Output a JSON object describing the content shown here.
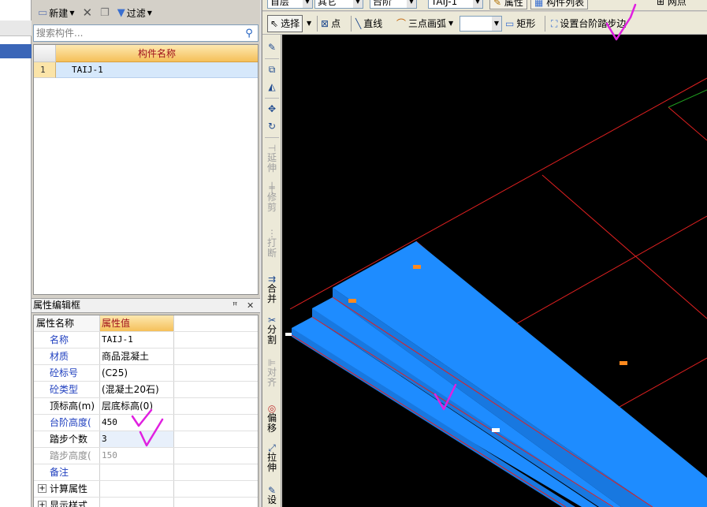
{
  "component_toolbar": {
    "new_label": "新建",
    "filter_label": "过滤"
  },
  "search": {
    "placeholder": "搜索构件..."
  },
  "component_list": {
    "header": "构件名称",
    "rows": [
      {
        "num": "1",
        "name": "TAIJ-1"
      }
    ]
  },
  "property_panel": {
    "title": "属性编辑框",
    "pin": "ꟸ",
    "close": "✕",
    "header_key": "属性名称",
    "header_value": "属性值",
    "rows": [
      {
        "key": "名称",
        "value": "TAIJ-1"
      },
      {
        "key": "材质",
        "value": "商品混凝土"
      },
      {
        "key": "砼标号",
        "value": "(C25)"
      },
      {
        "key": "砼类型",
        "value": "(混凝土20石)"
      },
      {
        "key": "顶标高(m)",
        "value": "层底标高(0)"
      },
      {
        "key": "台阶高度(",
        "value": "450"
      },
      {
        "key": "踏步个数",
        "value": "3"
      },
      {
        "key": "踏步高度(",
        "value": "150"
      },
      {
        "key": "备注",
        "value": ""
      },
      {
        "key": "计算属性",
        "value": ""
      },
      {
        "key": "显示样式",
        "value": ""
      }
    ]
  },
  "top_toolbar": {
    "floor_combo": "首层",
    "type_combo": "其它",
    "category_combo": "台阶",
    "component_combo": "TAIJ-1",
    "attr_button": "属性",
    "list_button": "构件列表",
    "grid_label": "网点"
  },
  "draw_toolbar": {
    "select": "选择",
    "point": "点",
    "line": "直线",
    "arc": "三点画弧",
    "rect": "矩形",
    "set_step_edge": "设置台阶踏步边"
  },
  "modify_toolbar": {
    "extend": [
      "延",
      "伸"
    ],
    "trim": [
      "修",
      "剪"
    ],
    "break": [
      "打",
      "断"
    ],
    "merge": [
      "合",
      "并"
    ],
    "split": [
      "分",
      "割"
    ],
    "align": [
      "对",
      "齐"
    ],
    "offset": [
      "偏",
      "移"
    ],
    "stretch": [
      "拉",
      "伸"
    ],
    "set": [
      "设"
    ]
  },
  "colors": {
    "step_fill": "#1e8cff",
    "step_shade": "#1878e0",
    "grid_line": "#e02020",
    "marker": "#ff8a1e",
    "annotation": "#e020e0",
    "canvas_bg": "#000000"
  }
}
